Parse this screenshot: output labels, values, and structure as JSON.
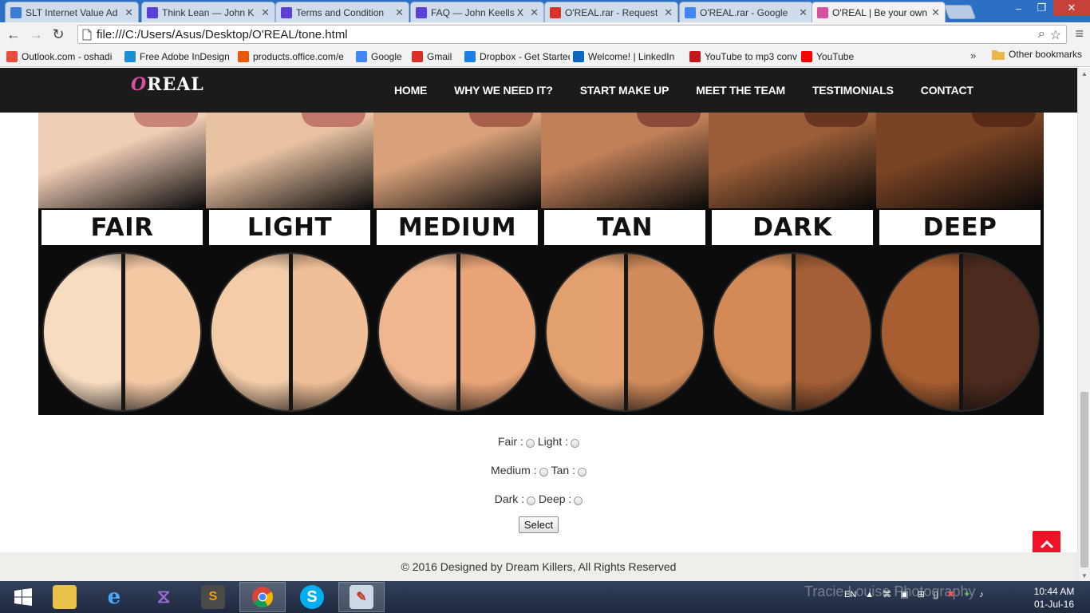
{
  "browser": {
    "tabs": [
      {
        "label": "SLT Internet Value Ad",
        "icon": "slt-icon",
        "color": "#3a7bd5"
      },
      {
        "label": "Think Lean — John K",
        "icon": "x-logo-icon",
        "color": "#5b3fd6"
      },
      {
        "label": "Terms and Condition",
        "icon": "x-logo-icon",
        "color": "#5b3fd6"
      },
      {
        "label": "FAQ — John Keells X",
        "icon": "x-logo-icon",
        "color": "#5b3fd6"
      },
      {
        "label": "O'REAL.rar - Request",
        "icon": "gmail-icon",
        "color": "#d93025"
      },
      {
        "label": "O'REAL.rar - Google",
        "icon": "google-docs-icon",
        "color": "#4285f4"
      },
      {
        "label": "O'REAL | Be your own",
        "icon": "oreal-icon",
        "color": "#d94fa0"
      }
    ],
    "url": "file:///C:/Users/Asus/Desktop/O'REAL/tone.html",
    "bookmarks": [
      {
        "label": "Outlook.com - oshadi",
        "icon": "windows-icon",
        "color": "#e74c3c"
      },
      {
        "label": "Free Adobe InDesign",
        "icon": "adobe-icon",
        "color": "#1a8fd6"
      },
      {
        "label": "products.office.com/e",
        "icon": "office-icon",
        "color": "#e8590c"
      },
      {
        "label": "Google",
        "icon": "google-icon",
        "color": "#4285f4"
      },
      {
        "label": "Gmail",
        "icon": "gmail-icon",
        "color": "#d93025"
      },
      {
        "label": "Dropbox - Get Started",
        "icon": "dropbox-icon",
        "color": "#1a7fe0"
      },
      {
        "label": "Welcome! | LinkedIn",
        "icon": "linkedin-icon",
        "color": "#0a66c2"
      },
      {
        "label": "YouTube to mp3 conv",
        "icon": "mp3-icon",
        "color": "#c4161c"
      },
      {
        "label": "YouTube",
        "icon": "youtube-icon",
        "color": "#ff0000"
      }
    ],
    "more_bookmarks": "»",
    "other_bookmarks": "Other bookmarks"
  },
  "site": {
    "logo": {
      "o": "O",
      "rest": "REAL"
    },
    "nav": [
      "HOME",
      "WHY WE NEED IT?",
      "START MAKE UP",
      "MEET THE TEAM",
      "TESTIMONIALS",
      "CONTACT"
    ]
  },
  "tones": [
    {
      "label": "FAIR",
      "skin": "#f0cdb6",
      "lip": "#c98579",
      "left": "#f7dcc0",
      "right": "#f3c9a4"
    },
    {
      "label": "LIGHT",
      "skin": "#e9c2a2",
      "lip": "#c2786a",
      "left": "#f4cca8",
      "right": "#f0bf97"
    },
    {
      "label": "MEDIUM",
      "skin": "#d9a179",
      "lip": "#a9604b",
      "left": "#efb68f",
      "right": "#e9a477"
    },
    {
      "label": "TAN",
      "skin": "#c18058",
      "lip": "#8a4a38",
      "left": "#e3a06f",
      "right": "#d18b5a"
    },
    {
      "label": "DARK",
      "skin": "#9a5d37",
      "lip": "#6a3620",
      "left": "#d48a55",
      "right": "#a45f36"
    },
    {
      "label": "DEEP",
      "skin": "#7a4324",
      "lip": "#5a2a18",
      "left": "#a85e30",
      "right": "#4d2a1e"
    }
  ],
  "form": {
    "rows": [
      [
        "Fair :",
        "Light :"
      ],
      [
        "Medium :",
        "Tan :"
      ],
      [
        "Dark :",
        "Deep :"
      ]
    ],
    "button": "Select"
  },
  "footer": "© 2016 Designed by Dream Killers, All Rights Reserved",
  "taskbar": {
    "watermark": "Tracie Louise Photography",
    "lang": "EN",
    "time": "10:44 AM",
    "date": "01-Jul-16"
  }
}
